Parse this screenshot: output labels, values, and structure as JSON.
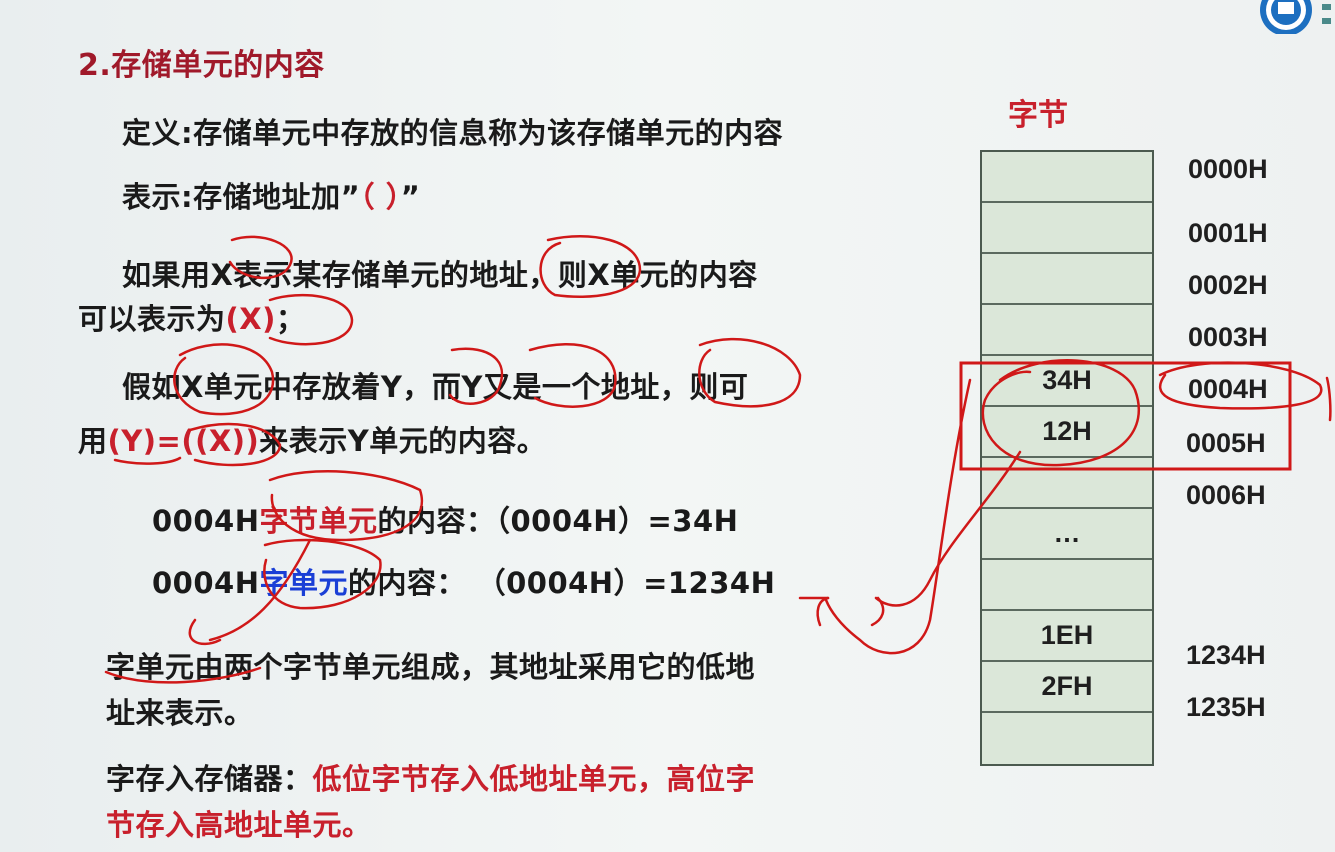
{
  "slide": {
    "title": "2.存储单元的内容",
    "definition": "定义:存储单元中存放的信息称为该存储单元的内容",
    "notation_prefix": "表示:存储地址加”",
    "notation_paren": "（ ）",
    "notation_suffix": "”",
    "para_x_line1": "如果用X表示某存储单元的地址，则X单元的内容",
    "para_x_line2_prefix": "可以表示为",
    "para_x_line2_expr": "(X)",
    "para_x_line2_suffix": "；",
    "para_y_line1": "假如X单元中存放着Y，而Y又是一个地址，则可",
    "para_y_line2_prefix": "用",
    "para_y_line2_expr": "(Y)=((X))",
    "para_y_line2_suffix": "来表示Y单元的内容。",
    "byte_example_addr": "0004H",
    "byte_example_unit": "字节单元",
    "byte_example_rest": "的内容：（0004H）=34H",
    "word_example_addr": "0004H",
    "word_example_unit": "字单元",
    "word_example_rest": "的内容：  （0004H）=1234H",
    "word_note_line1": "字单元由两个字节单元组成，其地址采用它的低地",
    "word_note_line2": "址来表示。",
    "storage_label": "字存入存储器：",
    "storage_rule_line1": "低位字节存入低地址单元，高位字",
    "storage_rule_line2": "节存入高地址单元。"
  },
  "memory": {
    "header": "字节",
    "cells": [
      "",
      "",
      "",
      "",
      "34H",
      "12H",
      "",
      "…",
      "",
      "1EH",
      "2FH",
      ""
    ],
    "addresses": [
      "0000H",
      "0001H",
      "0002H",
      "0003H",
      "0004H",
      "0005H",
      "0006H",
      "",
      "",
      "1234H",
      "1235H",
      ""
    ]
  },
  "colors": {
    "title": "#a0192a",
    "accent_red": "#c8202c",
    "accent_blue": "#1a3fd6",
    "cell_fill": "#dbe7d9",
    "annotation_red": "#d01818"
  },
  "icons": {
    "logo": "institution-logo-icon"
  }
}
